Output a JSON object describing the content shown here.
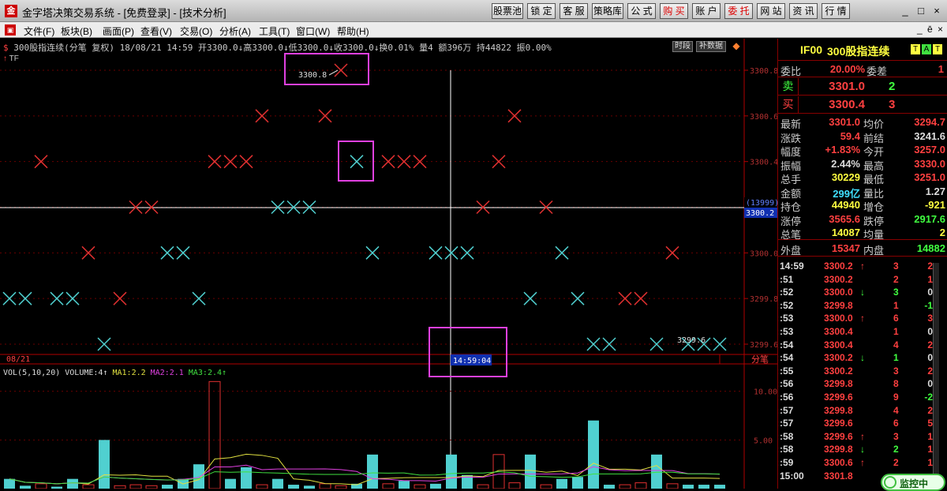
{
  "window": {
    "title": "金字塔决策交易系统 - [免费登录] - [技术分析]",
    "app_icon": "金",
    "toolbar_buttons": [
      {
        "label": "股票池",
        "red": false
      },
      {
        "label": "锁 定",
        "red": false
      },
      {
        "label": "客 服",
        "red": false
      },
      {
        "label": "策略库",
        "red": false
      },
      {
        "label": "公 式",
        "red": false
      },
      {
        "label": "购 买",
        "red": true
      },
      {
        "label": "账 户",
        "red": false
      },
      {
        "label": "委 托",
        "red": true
      },
      {
        "label": "网 站",
        "red": false
      },
      {
        "label": "资 讯",
        "red": false
      },
      {
        "label": "行 情",
        "red": false
      }
    ],
    "controls": {
      "minimize": "_",
      "restore": "□",
      "close": "×"
    }
  },
  "menu": {
    "items": [
      "文件(F)",
      "板块(B)",
      "画面(P)",
      "查看(V)",
      "交易(O)",
      "分析(A)",
      "工具(T)",
      "窗口(W)",
      "帮助(H)"
    ],
    "right_controls": [
      "_",
      "ē",
      "×"
    ]
  },
  "chart": {
    "info_line": "300股指连续(分笔 复权) 18/08/21 14:59 开3300.0↓高3300.0↓低3300.0↓收3300.0↓换0.01% 量4 额396万 持44822 振0.00%",
    "info_prefix": "$",
    "sub_label": "TF",
    "price_axis": [
      "3300.8",
      "3300.6",
      "3300.4",
      "3300.2",
      "3300.0",
      "3299.8",
      "3299.6"
    ],
    "current_price_tag": "3300.2",
    "count_tag": "(13999)",
    "max_label": "3300.8",
    "min_label": "3299.6",
    "crosshair_time": "14:59:04",
    "date_label": "08/21",
    "fenbi_label": "分笔",
    "buttons": {
      "timeframe": "时段",
      "supplement": "补数据"
    },
    "vol_info": {
      "prefix": "VOL(5,10,20) VOLUME:4↑",
      "ma1": "MA1:2.2",
      "ma2": "MA2:2.1",
      "ma3": "MA3:2.4↑"
    },
    "vol_axis": [
      "10.00",
      "5.00"
    ],
    "colors": {
      "up": "#e03030",
      "down": "#50d0d0",
      "ma1": "#e0e040",
      "ma2": "#e040e0",
      "ma3": "#40e040"
    }
  },
  "chart_data": {
    "type": "scatter",
    "ylim": [
      3299.6,
      3300.8
    ],
    "ticks_red": [
      {
        "x": 52,
        "y": 3300.4
      },
      {
        "x": 112,
        "y": 3300.0
      },
      {
        "x": 152,
        "y": 3299.8
      },
      {
        "x": 172,
        "y": 3300.2
      },
      {
        "x": 192,
        "y": 3300.2
      },
      {
        "x": 272,
        "y": 3300.4
      },
      {
        "x": 292,
        "y": 3300.4
      },
      {
        "x": 312,
        "y": 3300.4
      },
      {
        "x": 332,
        "y": 3300.6
      },
      {
        "x": 412,
        "y": 3300.6
      },
      {
        "x": 432,
        "y": 3300.8
      },
      {
        "x": 492,
        "y": 3300.4
      },
      {
        "x": 512,
        "y": 3300.4
      },
      {
        "x": 532,
        "y": 3300.4
      },
      {
        "x": 612,
        "y": 3300.2
      },
      {
        "x": 632,
        "y": 3300.4
      },
      {
        "x": 652,
        "y": 3300.6
      },
      {
        "x": 692,
        "y": 3300.2
      },
      {
        "x": 792,
        "y": 3299.8
      },
      {
        "x": 812,
        "y": 3299.8
      },
      {
        "x": 852,
        "y": 3300.0
      }
    ],
    "ticks_cyan": [
      {
        "x": 12,
        "y": 3299.8
      },
      {
        "x": 32,
        "y": 3299.8
      },
      {
        "x": 72,
        "y": 3299.8
      },
      {
        "x": 92,
        "y": 3299.8
      },
      {
        "x": 132,
        "y": 3299.6
      },
      {
        "x": 212,
        "y": 3300.0
      },
      {
        "x": 232,
        "y": 3300.0
      },
      {
        "x": 252,
        "y": 3299.8
      },
      {
        "x": 352,
        "y": 3300.2
      },
      {
        "x": 372,
        "y": 3300.2
      },
      {
        "x": 392,
        "y": 3300.2
      },
      {
        "x": 452,
        "y": 3300.4
      },
      {
        "x": 472,
        "y": 3300.0
      },
      {
        "x": 552,
        "y": 3300.0
      },
      {
        "x": 572,
        "y": 3300.0
      },
      {
        "x": 592,
        "y": 3300.0
      },
      {
        "x": 672,
        "y": 3299.8
      },
      {
        "x": 712,
        "y": 3300.0
      },
      {
        "x": 732,
        "y": 3299.8
      },
      {
        "x": 752,
        "y": 3299.6
      },
      {
        "x": 772,
        "y": 3299.6
      },
      {
        "x": 832,
        "y": 3299.6
      },
      {
        "x": 872,
        "y": 3299.6
      },
      {
        "x": 892,
        "y": 3299.6
      },
      {
        "x": 912,
        "y": 3299.6
      }
    ],
    "volume_ylim": [
      0,
      12
    ],
    "volume": [
      {
        "x": 12,
        "v": 1,
        "c": "down"
      },
      {
        "x": 32,
        "v": 0.3,
        "c": "down"
      },
      {
        "x": 52,
        "v": 0.5,
        "c": "up"
      },
      {
        "x": 72,
        "v": 0.2,
        "c": "down"
      },
      {
        "x": 92,
        "v": 1,
        "c": "down"
      },
      {
        "x": 112,
        "v": 0.4,
        "c": "up"
      },
      {
        "x": 132,
        "v": 5,
        "c": "down"
      },
      {
        "x": 152,
        "v": 0.3,
        "c": "up"
      },
      {
        "x": 172,
        "v": 0.4,
        "c": "up"
      },
      {
        "x": 192,
        "v": 0.3,
        "c": "up"
      },
      {
        "x": 212,
        "v": 0.4,
        "c": "down"
      },
      {
        "x": 232,
        "v": 1,
        "c": "down"
      },
      {
        "x": 252,
        "v": 2.5,
        "c": "down"
      },
      {
        "x": 272,
        "v": 11,
        "c": "up"
      },
      {
        "x": 292,
        "v": 1,
        "c": "down"
      },
      {
        "x": 312,
        "v": 2.2,
        "c": "down"
      },
      {
        "x": 332,
        "v": 0.4,
        "c": "up"
      },
      {
        "x": 352,
        "v": 1,
        "c": "down"
      },
      {
        "x": 372,
        "v": 0.4,
        "c": "down"
      },
      {
        "x": 392,
        "v": 0.3,
        "c": "down"
      },
      {
        "x": 412,
        "v": 0.5,
        "c": "up"
      },
      {
        "x": 432,
        "v": 0.3,
        "c": "up"
      },
      {
        "x": 452,
        "v": 0.5,
        "c": "down"
      },
      {
        "x": 472,
        "v": 3.5,
        "c": "down"
      },
      {
        "x": 492,
        "v": 0.5,
        "c": "up"
      },
      {
        "x": 512,
        "v": 0.8,
        "c": "down"
      },
      {
        "x": 532,
        "v": 0.4,
        "c": "up"
      },
      {
        "x": 552,
        "v": 0.5,
        "c": "down"
      },
      {
        "x": 572,
        "v": 3.5,
        "c": "down"
      },
      {
        "x": 592,
        "v": 1.4,
        "c": "down"
      },
      {
        "x": 612,
        "v": 0.4,
        "c": "up"
      },
      {
        "x": 632,
        "v": 3.5,
        "c": "up"
      },
      {
        "x": 652,
        "v": 0.6,
        "c": "up"
      },
      {
        "x": 672,
        "v": 3.5,
        "c": "down"
      },
      {
        "x": 692,
        "v": 0.4,
        "c": "up"
      },
      {
        "x": 712,
        "v": 1,
        "c": "down"
      },
      {
        "x": 732,
        "v": 1.2,
        "c": "down"
      },
      {
        "x": 752,
        "v": 7,
        "c": "down"
      },
      {
        "x": 772,
        "v": 0.4,
        "c": "down"
      },
      {
        "x": 792,
        "v": 0.4,
        "c": "up"
      },
      {
        "x": 812,
        "v": 0.6,
        "c": "up"
      },
      {
        "x": 832,
        "v": 3.5,
        "c": "down"
      },
      {
        "x": 852,
        "v": 0.5,
        "c": "up"
      },
      {
        "x": 872,
        "v": 0.4,
        "c": "down"
      },
      {
        "x": 892,
        "v": 0.4,
        "c": "down"
      },
      {
        "x": 912,
        "v": 0.4,
        "c": "down"
      }
    ]
  },
  "right_panel": {
    "code": "IF00",
    "name": "300股指连续",
    "badges": [
      "T",
      "A",
      "T"
    ],
    "weibi": {
      "label": "委比",
      "value": "20.00%",
      "diff_label": "委差",
      "diff": "1"
    },
    "sell": {
      "label": "卖",
      "price": "3301.0",
      "qty": "2"
    },
    "buy": {
      "label": "买",
      "price": "3300.4",
      "qty": "3"
    },
    "stats": [
      {
        "l1": "最新",
        "v1": "3301.0",
        "c1": "#ff4040",
        "l2": "均价",
        "v2": "3294.7",
        "c2": "#ff4040"
      },
      {
        "l1": "涨跌",
        "v1": "59.4",
        "c1": "#ff4040",
        "l2": "前结",
        "v2": "3241.6",
        "c2": "#ddd"
      },
      {
        "l1": "幅度",
        "v1": "+1.83%",
        "c1": "#ff4040",
        "l2": "今开",
        "v2": "3257.0",
        "c2": "#ff4040"
      },
      {
        "l1": "振幅",
        "v1": "2.44%",
        "c1": "#ddd",
        "l2": "最高",
        "v2": "3330.0",
        "c2": "#ff4040"
      },
      {
        "l1": "总手",
        "v1": "30229",
        "c1": "#ffff40",
        "l2": "最低",
        "v2": "3251.0",
        "c2": "#ff4040"
      },
      {
        "l1": "金额",
        "v1": "299亿",
        "c1": "#40e0ff",
        "l2": "量比",
        "v2": "1.27",
        "c2": "#ddd"
      },
      {
        "l1": "持仓",
        "v1": "44940",
        "c1": "#ffff40",
        "l2": "增仓",
        "v2": "-921",
        "c2": "#ffff40"
      },
      {
        "l1": "涨停",
        "v1": "3565.6",
        "c1": "#ff4040",
        "l2": "跌停",
        "v2": "2917.6",
        "c2": "#40ff40"
      },
      {
        "l1": "总笔",
        "v1": "14087",
        "c1": "#ffff40",
        "l2": "均量",
        "v2": "2",
        "c2": "#ffff40"
      }
    ],
    "outer": {
      "label": "外盘",
      "value": "15347",
      "inner_label": "内盘",
      "inner": "14882"
    },
    "ticks": [
      {
        "t": "14:59",
        "p": "3300.2",
        "a": "↑",
        "ac": "#ff4040",
        "v": "3",
        "d": "2",
        "dc": "#ff4040"
      },
      {
        "t": ":51",
        "p": "3300.2",
        "a": "",
        "ac": "",
        "v": "2",
        "d": "1",
        "dc": "#ff4040"
      },
      {
        "t": ":52",
        "p": "3300.0",
        "a": "↓",
        "ac": "#40ff40",
        "v": "3",
        "d": "0",
        "dc": "#ddd"
      },
      {
        "t": ":52",
        "p": "3299.8",
        "a": "",
        "ac": "",
        "v": "1",
        "d": "-1",
        "dc": "#40ff40"
      },
      {
        "t": ":53",
        "p": "3300.0",
        "a": "↑",
        "ac": "#ff4040",
        "v": "6",
        "d": "3",
        "dc": "#ff4040"
      },
      {
        "t": ":53",
        "p": "3300.4",
        "a": "",
        "ac": "",
        "v": "1",
        "d": "0",
        "dc": "#ddd"
      },
      {
        "t": ":54",
        "p": "3300.4",
        "a": "",
        "ac": "",
        "v": "4",
        "d": "2",
        "dc": "#ff4040"
      },
      {
        "t": ":54",
        "p": "3300.2",
        "a": "↓",
        "ac": "#40ff40",
        "v": "1",
        "d": "0",
        "dc": "#ddd"
      },
      {
        "t": ":55",
        "p": "3300.2",
        "a": "",
        "ac": "",
        "v": "3",
        "d": "2",
        "dc": "#ff4040"
      },
      {
        "t": ":56",
        "p": "3299.8",
        "a": "",
        "ac": "",
        "v": "8",
        "d": "0",
        "dc": "#ddd"
      },
      {
        "t": ":56",
        "p": "3299.6",
        "a": "",
        "ac": "",
        "v": "9",
        "d": "-2",
        "dc": "#40ff40"
      },
      {
        "t": ":57",
        "p": "3299.8",
        "a": "",
        "ac": "",
        "v": "4",
        "d": "2",
        "dc": "#ff4040"
      },
      {
        "t": ":57",
        "p": "3299.6",
        "a": "",
        "ac": "",
        "v": "6",
        "d": "5",
        "dc": "#ff4040"
      },
      {
        "t": ":58",
        "p": "3299.6",
        "a": "↑",
        "ac": "#ff4040",
        "v": "3",
        "d": "1",
        "dc": "#ff4040"
      },
      {
        "t": ":58",
        "p": "3299.8",
        "a": "↓",
        "ac": "#40ff40",
        "v": "2",
        "d": "1",
        "dc": "#ff4040"
      },
      {
        "t": ":59",
        "p": "3300.6",
        "a": "↑",
        "ac": "#ff4040",
        "v": "2",
        "d": "1",
        "dc": "#ff4040"
      },
      {
        "t": "15:00",
        "p": "3301.8",
        "a": "",
        "ac": "",
        "v": "",
        "d": "",
        "dc": ""
      }
    ],
    "monitor_label": "监控中"
  }
}
